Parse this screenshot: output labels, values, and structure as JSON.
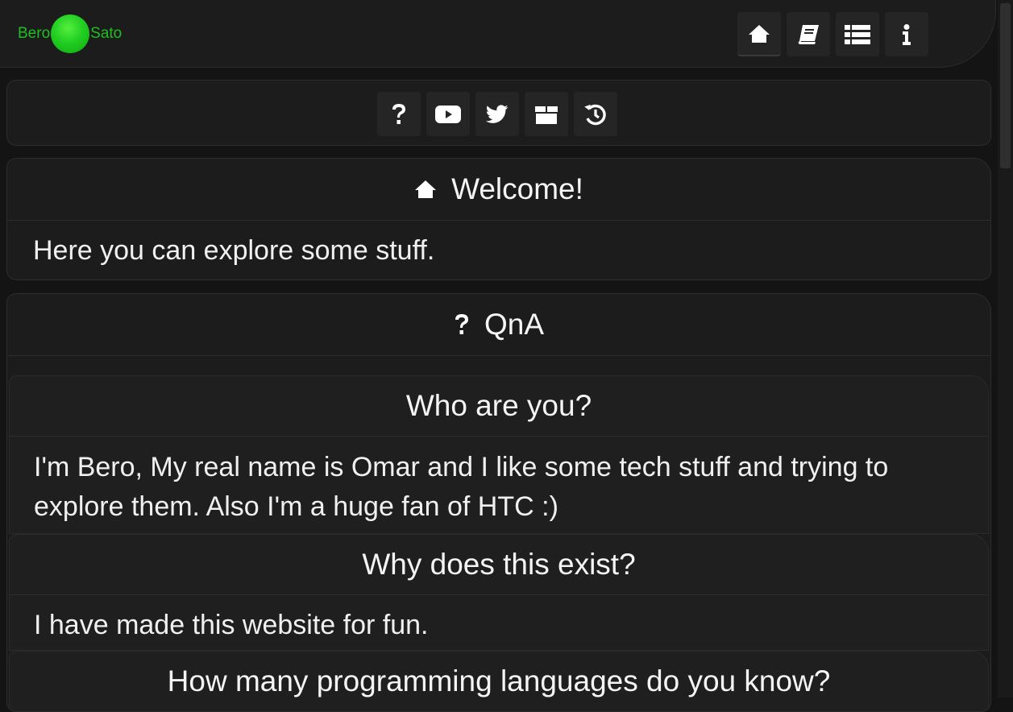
{
  "brand": {
    "left": "Bero",
    "right": "Sato"
  },
  "nav": [
    "home-icon",
    "book-icon",
    "list-icon",
    "info-icon"
  ],
  "social": [
    "question-icon",
    "youtube-icon",
    "twitter-icon",
    "gift-icon",
    "history-icon"
  ],
  "welcome": {
    "title": "Welcome!",
    "text": "Here you can explore some stuff."
  },
  "qna": {
    "title": "QnA",
    "items": [
      {
        "q": "Who are you?",
        "a": "I'm Bero, My real name is Omar and I like some tech stuff and trying to explore them. Also I'm a huge fan of HTC :)"
      },
      {
        "q": "Why does this exist?",
        "a": "I have made this website for fun."
      },
      {
        "q": "How many programming languages do you know?",
        "a": ""
      }
    ]
  },
  "colors": {
    "brand_green": "#1fbf1f",
    "background": "#141414",
    "panel": "#1c1c1c",
    "button": "#252525"
  }
}
